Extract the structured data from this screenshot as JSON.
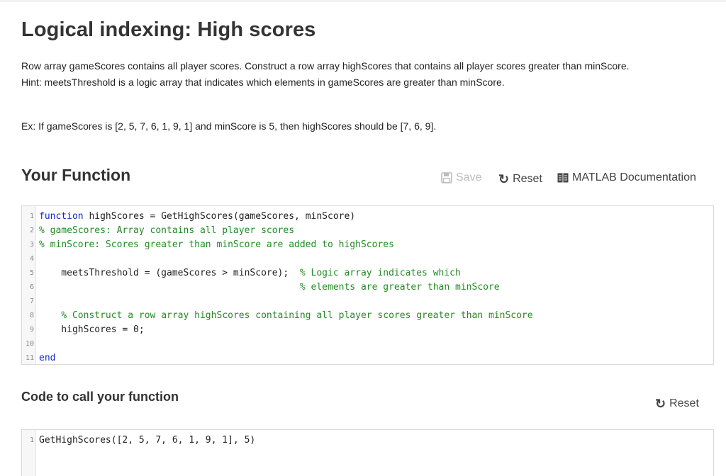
{
  "title": "Logical indexing: High scores",
  "description": {
    "line1": "Row array gameScores contains all player scores. Construct a row array highScores that contains all player scores greater than minScore.",
    "line2": "Hint: meetsThreshold is a logic array that indicates which elements in gameScores are greater than minScore.",
    "example": "Ex: If gameScores is [2, 5, 7, 6, 1, 9, 1] and minScore is 5, then highScores should be [7, 6, 9]."
  },
  "your_function": {
    "heading": "Your Function",
    "toolbar": {
      "save_label": "Save",
      "reset_label": "Reset",
      "docs_label": "MATLAB Documentation"
    },
    "code": [
      {
        "num": "1",
        "kw": "function",
        "text": " highScores = GetHighScores(gameScores, minScore)",
        "comment": "",
        "trail": ""
      },
      {
        "num": "2",
        "kw": "",
        "text": "",
        "comment": "% gameScores: Array contains all player scores",
        "trail": ""
      },
      {
        "num": "3",
        "kw": "",
        "text": "",
        "comment": "% minScore: Scores greater than minScore are added to highScores",
        "trail": ""
      },
      {
        "num": "4",
        "kw": "",
        "text": "",
        "comment": "",
        "trail": ""
      },
      {
        "num": "5",
        "kw": "",
        "text": "    meetsThreshold = (gameScores > minScore);  ",
        "comment": "% Logic array indicates which",
        "trail": ""
      },
      {
        "num": "6",
        "kw": "",
        "text": "                                               ",
        "comment": "% elements are greater than minScore",
        "trail": ""
      },
      {
        "num": "7",
        "kw": "",
        "text": "",
        "comment": "",
        "trail": ""
      },
      {
        "num": "8",
        "kw": "",
        "text": "    ",
        "comment": "% Construct a row array highScores containing all player scores greater than minScore",
        "trail": ""
      },
      {
        "num": "9",
        "kw": "",
        "text": "    highScores = 0;",
        "comment": "",
        "trail": ""
      },
      {
        "num": "10",
        "kw": "",
        "text": "",
        "comment": "",
        "trail": ""
      },
      {
        "num": "11",
        "kw": "end",
        "text": "",
        "comment": "",
        "trail": ""
      }
    ]
  },
  "call_function": {
    "heading": "Code to call your function",
    "reset_label": "Reset",
    "code": [
      {
        "num": "1",
        "text": "GetHighScores([2, 5, 7, 6, 1, 9, 1], 5)"
      }
    ]
  },
  "colors": {
    "keyword": "#0e2ad8",
    "comment": "#228b22",
    "disabled": "#bcbcbc"
  },
  "icons": {
    "save": "floppy-disk-icon",
    "reset": "rotate-cw-icon",
    "docs": "book-icon"
  }
}
